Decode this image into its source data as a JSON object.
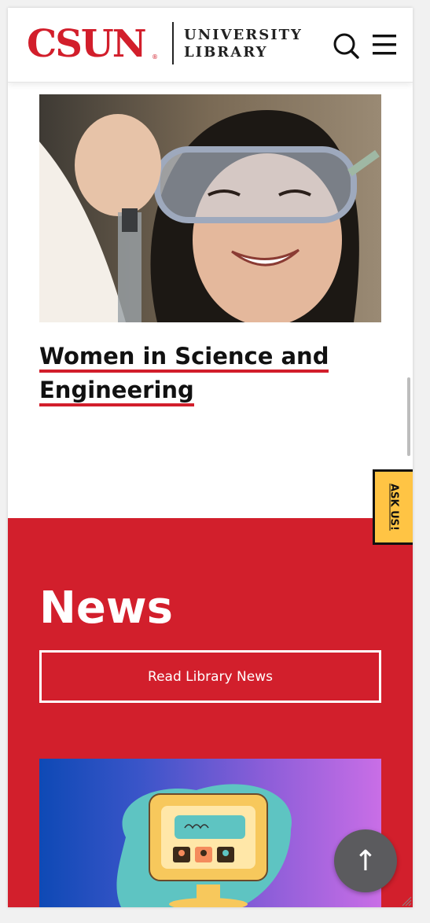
{
  "header": {
    "logo_text": "CSUN",
    "logo_reg": "®",
    "library_line1": "UNIVERSITY",
    "library_line2": "LIBRARY",
    "search_icon": "search-icon",
    "menu_icon": "hamburger-menu-icon"
  },
  "feature": {
    "title": "Women in Science and Engineering",
    "image": "student-in-safety-goggles-photo"
  },
  "ask_tab": {
    "label": "ASK US!"
  },
  "news": {
    "heading": "News",
    "button_label": "Read Library News",
    "card_image": "computer-illustration"
  },
  "back_to_top": {
    "label": "↑"
  },
  "colors": {
    "brand_red": "#d21e2b",
    "news_bg": "#d21f2c",
    "ask_yellow": "#ffc444",
    "to_top_gray": "#5b5b5e"
  }
}
